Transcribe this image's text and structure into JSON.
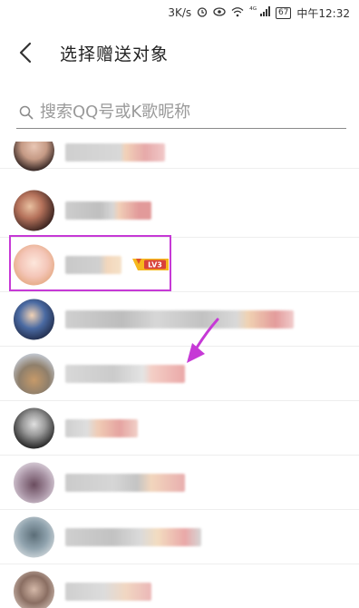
{
  "status_bar": {
    "net_speed": "3K/s",
    "signal_label": "⁴ᴳ",
    "battery": "67",
    "time": "中午12:32"
  },
  "header": {
    "title": "选择赠送对象",
    "back_icon": "chevron-left-icon"
  },
  "search": {
    "placeholder": "搜索QQ号或K歌昵称",
    "icon": "search-icon"
  },
  "friends": {
    "selected_level_badge": "LV3",
    "highlight_color": "#c639d6"
  }
}
